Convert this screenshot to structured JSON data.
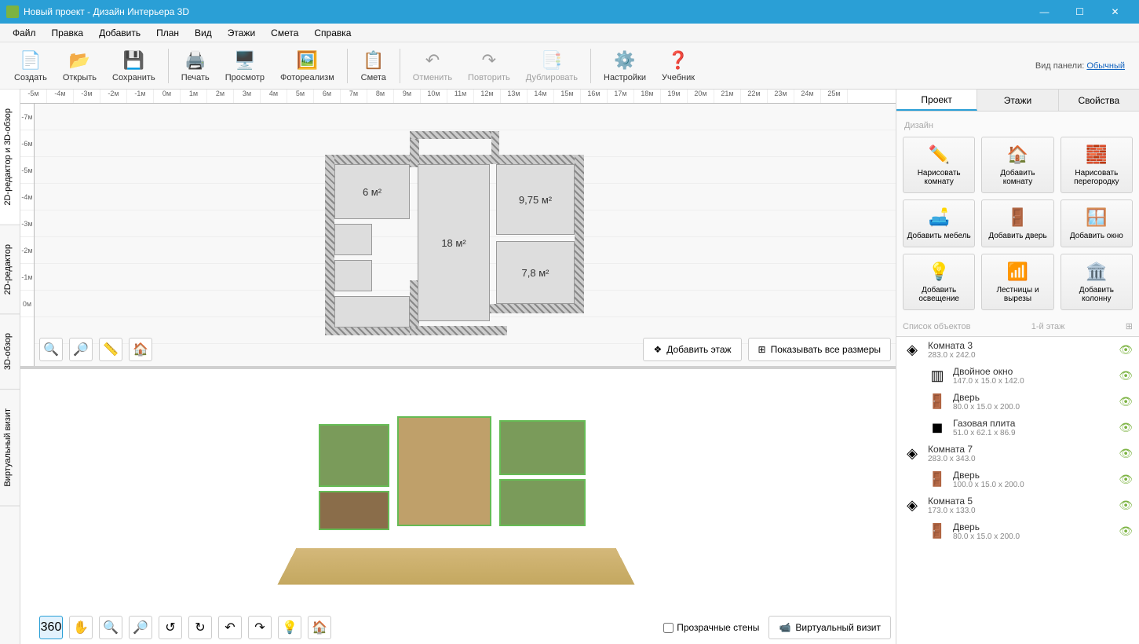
{
  "title": "Новый проект - Дизайн Интерьера 3D",
  "win": {
    "min": "—",
    "max": "☐",
    "close": "✕"
  },
  "menu": [
    "Файл",
    "Правка",
    "Добавить",
    "План",
    "Вид",
    "Этажи",
    "Смета",
    "Справка"
  ],
  "toolbar": [
    {
      "id": "create",
      "label": "Создать",
      "icon": "📄"
    },
    {
      "id": "open",
      "label": "Открыть",
      "icon": "📂"
    },
    {
      "id": "save",
      "label": "Сохранить",
      "icon": "💾"
    },
    {
      "sep": true
    },
    {
      "id": "print",
      "label": "Печать",
      "icon": "🖨️"
    },
    {
      "id": "preview",
      "label": "Просмотр",
      "icon": "🖥️"
    },
    {
      "id": "photoreal",
      "label": "Фотореализм",
      "icon": "🖼️"
    },
    {
      "sep": true
    },
    {
      "id": "estimate",
      "label": "Смета",
      "icon": "📋"
    },
    {
      "sep": true
    },
    {
      "id": "undo",
      "label": "Отменить",
      "icon": "↶",
      "disabled": true
    },
    {
      "id": "redo",
      "label": "Повторить",
      "icon": "↷",
      "disabled": true
    },
    {
      "id": "dup",
      "label": "Дублировать",
      "icon": "📑",
      "disabled": true
    },
    {
      "sep": true
    },
    {
      "id": "settings",
      "label": "Настройки",
      "icon": "⚙️"
    },
    {
      "id": "help",
      "label": "Учебник",
      "icon": "❓"
    }
  ],
  "panel_view": {
    "label": "Вид панели:",
    "value": "Обычный"
  },
  "side_tabs": [
    "2D-редактор и 3D-обзор",
    "2D-редактор",
    "3D-обзор",
    "Виртуальный визит"
  ],
  "side_tabs_active": 0,
  "ruler_h": [
    "-5м",
    "-4м",
    "-3м",
    "-2м",
    "-1м",
    "0м",
    "1м",
    "2м",
    "3м",
    "4м",
    "5м",
    "6м",
    "7м",
    "8м",
    "9м",
    "10м",
    "11м",
    "12м",
    "13м",
    "14м",
    "15м",
    "16м",
    "17м",
    "18м",
    "19м",
    "20м",
    "21м",
    "22м",
    "23м",
    "24м",
    "25м"
  ],
  "ruler_v": [
    "-7м",
    "-6м",
    "-5м",
    "-4м",
    "-3м",
    "-2м",
    "-1м",
    "0м"
  ],
  "rooms_2d": {
    "r1": "6 м²",
    "r2": "18 м²",
    "r3": "9,75 м²",
    "r4": "7,8 м²"
  },
  "view2d_actions": {
    "add_floor": "Добавить этаж",
    "show_sizes": "Показывать все размеры"
  },
  "view3d_actions": {
    "transparent": "Прозрачные стены",
    "virtual": "Виртуальный визит"
  },
  "right_tabs": [
    "Проект",
    "Этажи",
    "Свойства"
  ],
  "right_tabs_active": 0,
  "design_section": "Дизайн",
  "design_buttons": [
    {
      "id": "draw-room",
      "label": "Нарисовать комнату",
      "icon": "✏️"
    },
    {
      "id": "add-room",
      "label": "Добавить комнату",
      "icon": "🏠"
    },
    {
      "id": "draw-wall",
      "label": "Нарисовать перегородку",
      "icon": "🧱"
    },
    {
      "id": "add-furniture",
      "label": "Добавить мебель",
      "icon": "🛋️"
    },
    {
      "id": "add-door",
      "label": "Добавить дверь",
      "icon": "🚪"
    },
    {
      "id": "add-window",
      "label": "Добавить окно",
      "icon": "🪟"
    },
    {
      "id": "add-light",
      "label": "Добавить освещение",
      "icon": "💡"
    },
    {
      "id": "stairs",
      "label": "Лестницы и вырезы",
      "icon": "📶"
    },
    {
      "id": "add-column",
      "label": "Добавить колонну",
      "icon": "🏛️"
    }
  ],
  "obj_section": "Список объектов",
  "obj_floor": "1-й этаж",
  "objects": [
    {
      "type": "room",
      "name": "Комната 3",
      "size": "283.0 x 242.0",
      "icon": "◈"
    },
    {
      "type": "window",
      "name": "Двойное окно",
      "size": "147.0 x 15.0 x 142.0",
      "icon": "▥",
      "indent": true
    },
    {
      "type": "door",
      "name": "Дверь",
      "size": "80.0 x 15.0 x 200.0",
      "icon": "🚪",
      "indent": true
    },
    {
      "type": "stove",
      "name": "Газовая плита",
      "size": "51.0 x 62.1 x 86.9",
      "icon": "◼",
      "indent": true
    },
    {
      "type": "room",
      "name": "Комната 7",
      "size": "283.0 x 343.0",
      "icon": "◈"
    },
    {
      "type": "door",
      "name": "Дверь",
      "size": "100.0 x 15.0 x 200.0",
      "icon": "🚪",
      "indent": true
    },
    {
      "type": "room",
      "name": "Комната 5",
      "size": "173.0 x 133.0",
      "icon": "◈"
    },
    {
      "type": "door",
      "name": "Дверь",
      "size": "80.0 x 15.0 x 200.0",
      "icon": "🚪",
      "indent": true
    }
  ]
}
